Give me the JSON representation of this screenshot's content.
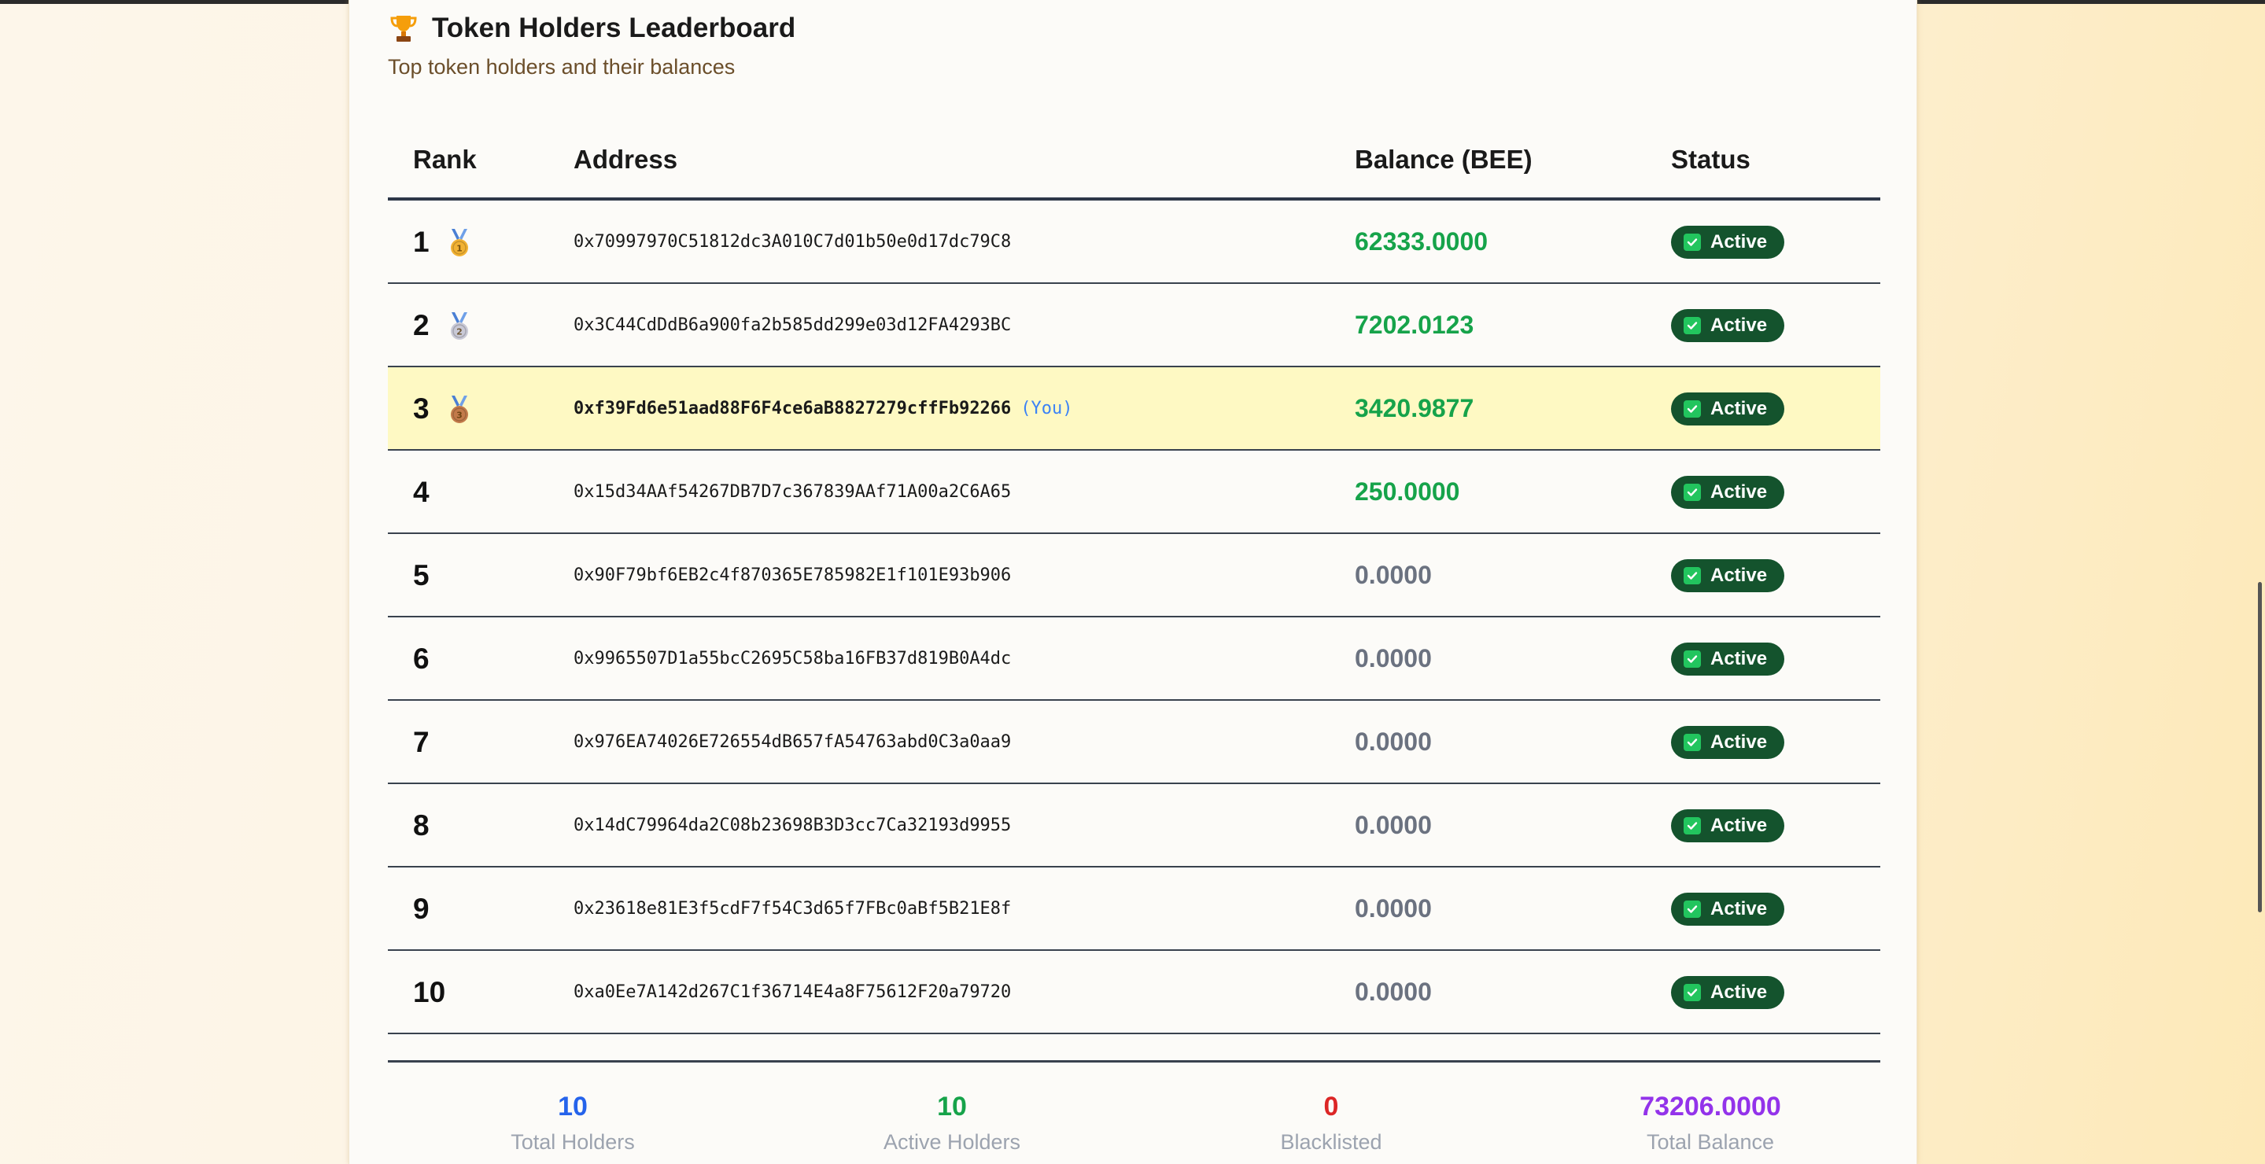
{
  "header": {
    "title": "Token Holders Leaderboard",
    "subtitle": "Top token holders and their balances",
    "icon": "trophy-icon"
  },
  "table": {
    "columns": [
      "Rank",
      "Address",
      "Balance (BEE)",
      "Status"
    ],
    "you_label": "(You)",
    "rows": [
      {
        "rank": "1",
        "medal": "gold",
        "address": "0x70997970C51812dc3A010C7d01b50e0d17dc79C8",
        "balance": "62333.0000",
        "status": "Active",
        "you": false
      },
      {
        "rank": "2",
        "medal": "silver",
        "address": "0x3C44CdDdB6a900fa2b585dd299e03d12FA4293BC",
        "balance": "7202.0123",
        "status": "Active",
        "you": false
      },
      {
        "rank": "3",
        "medal": "bronze",
        "address": "0xf39Fd6e51aad88F6F4ce6aB8827279cffFb92266",
        "balance": "3420.9877",
        "status": "Active",
        "you": true
      },
      {
        "rank": "4",
        "medal": "",
        "address": "0x15d34AAf54267DB7D7c367839AAf71A00a2C6A65",
        "balance": "250.0000",
        "status": "Active",
        "you": false
      },
      {
        "rank": "5",
        "medal": "",
        "address": "0x90F79bf6EB2c4f870365E785982E1f101E93b906",
        "balance": "0.0000",
        "status": "Active",
        "you": false
      },
      {
        "rank": "6",
        "medal": "",
        "address": "0x9965507D1a55bcC2695C58ba16FB37d819B0A4dc",
        "balance": "0.0000",
        "status": "Active",
        "you": false
      },
      {
        "rank": "7",
        "medal": "",
        "address": "0x976EA74026E726554dB657fA54763abd0C3a0aa9",
        "balance": "0.0000",
        "status": "Active",
        "you": false
      },
      {
        "rank": "8",
        "medal": "",
        "address": "0x14dC79964da2C08b23698B3D3cc7Ca32193d9955",
        "balance": "0.0000",
        "status": "Active",
        "you": false
      },
      {
        "rank": "9",
        "medal": "",
        "address": "0x23618e81E3f5cdF7f54C3d65f7FBc0aBf5B21E8f",
        "balance": "0.0000",
        "status": "Active",
        "you": false
      },
      {
        "rank": "10",
        "medal": "",
        "address": "0xa0Ee7A142d267C1f36714E4a8F75612F20a79720",
        "balance": "0.0000",
        "status": "Active",
        "you": false
      }
    ]
  },
  "stats": [
    {
      "value": "10",
      "label": "Total Holders",
      "color": "#2563eb"
    },
    {
      "value": "10",
      "label": "Active Holders",
      "color": "#16a34a"
    },
    {
      "value": "0",
      "label": "Blacklisted",
      "color": "#dc2626"
    },
    {
      "value": "73206.0000",
      "label": "Total Balance",
      "color": "#9333ea"
    }
  ],
  "colors": {
    "positive_balance": "#16a34a",
    "zero_balance": "#6b7280",
    "status_badge": "#14532d",
    "you_highlight": "#fef9c3"
  }
}
